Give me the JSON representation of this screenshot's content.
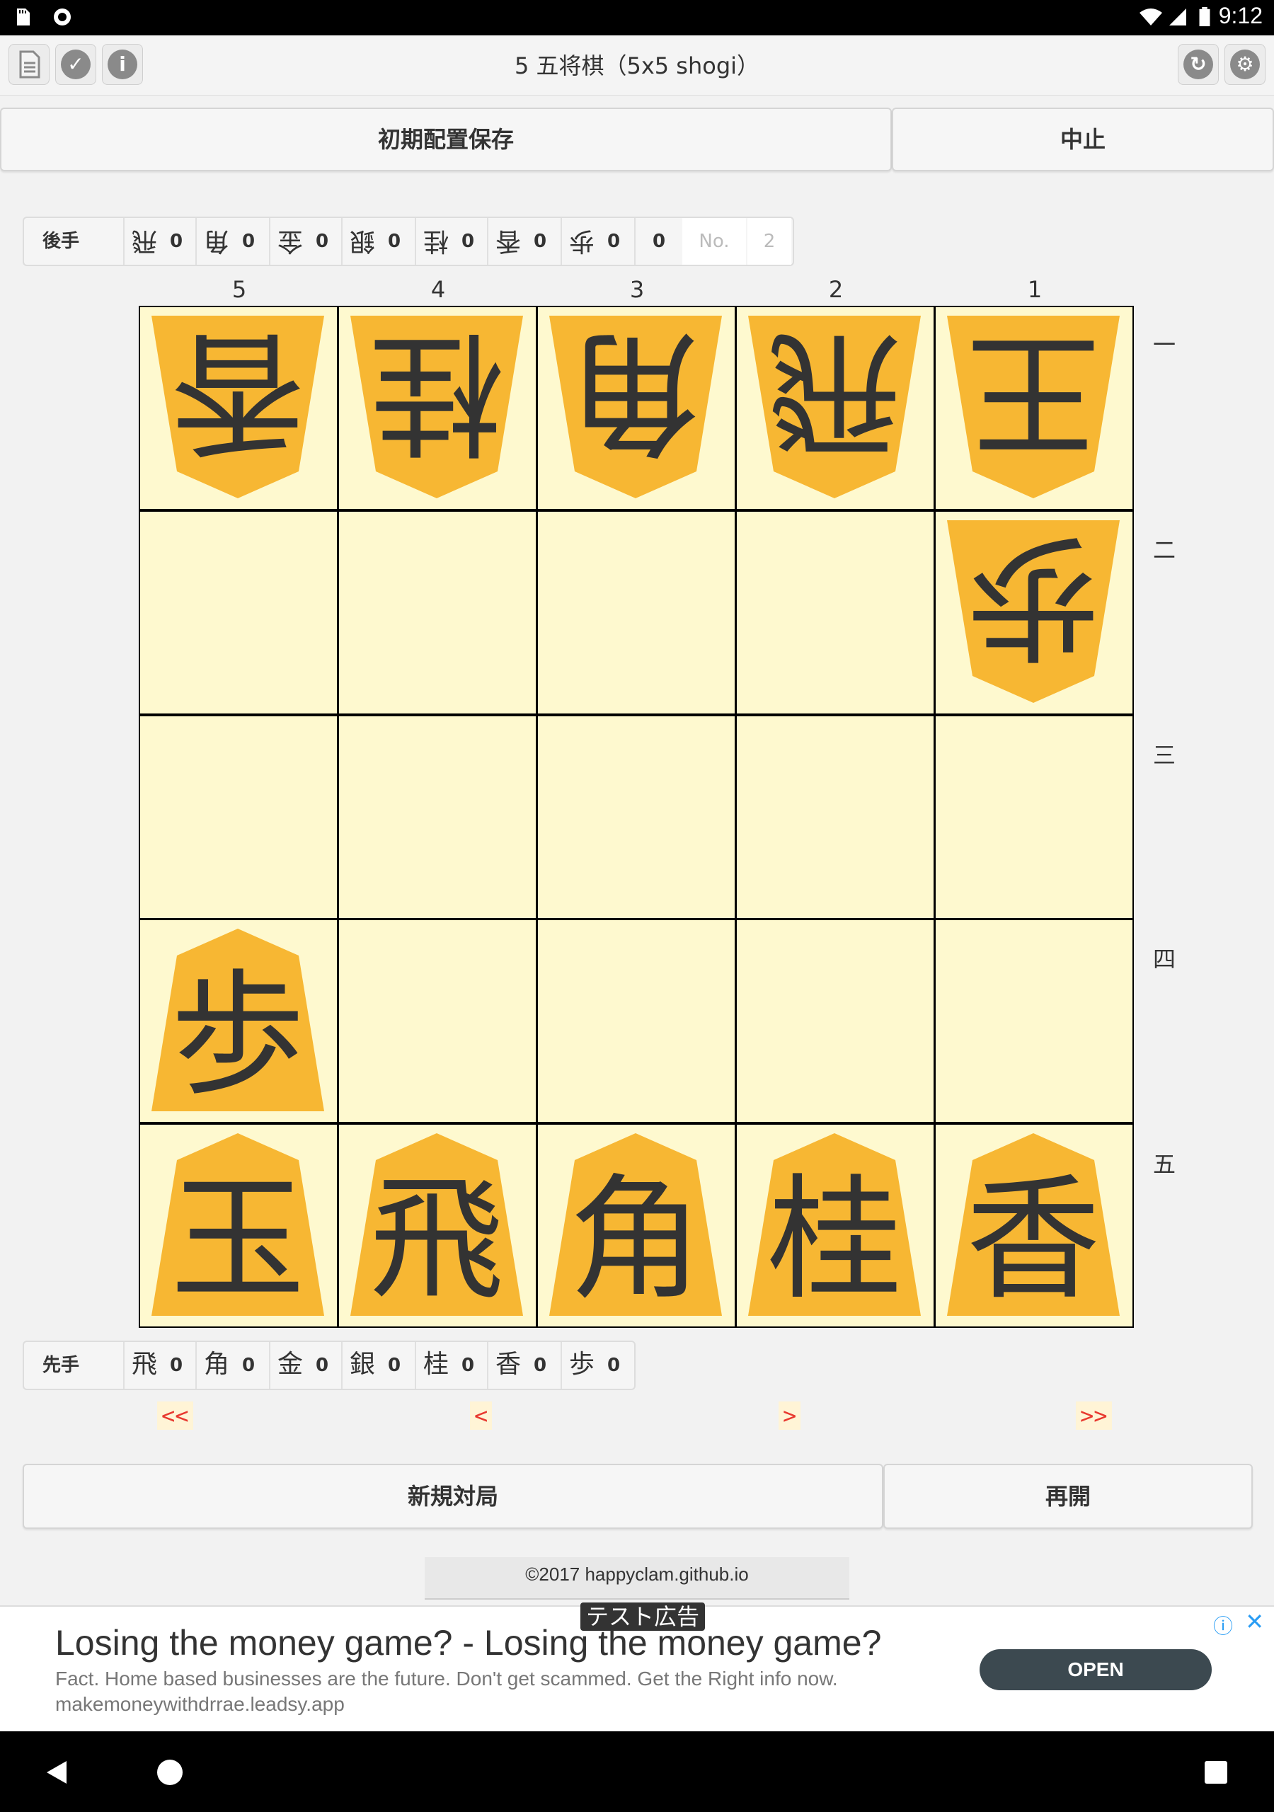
{
  "status_bar": {
    "time": "9:12"
  },
  "title": "5 五将棋（5x5 shogi）",
  "toolbar": {
    "save_initial": "初期配置保存",
    "abort": "中止"
  },
  "gote": {
    "label": "後手",
    "captured": [
      {
        "kanji": "飛",
        "count": "0"
      },
      {
        "kanji": "角",
        "count": "0"
      },
      {
        "kanji": "金",
        "count": "0"
      },
      {
        "kanji": "銀",
        "count": "0"
      },
      {
        "kanji": "桂",
        "count": "0"
      },
      {
        "kanji": "香",
        "count": "0"
      },
      {
        "kanji": "歩",
        "count": "0"
      }
    ],
    "extra_count": "0",
    "no_label": "No.",
    "move_no": "2"
  },
  "sente": {
    "label": "先手",
    "captured": [
      {
        "kanji": "飛",
        "count": "0"
      },
      {
        "kanji": "角",
        "count": "0"
      },
      {
        "kanji": "金",
        "count": "0"
      },
      {
        "kanji": "銀",
        "count": "0"
      },
      {
        "kanji": "桂",
        "count": "0"
      },
      {
        "kanji": "香",
        "count": "0"
      },
      {
        "kanji": "歩",
        "count": "0"
      }
    ]
  },
  "board": {
    "columns": [
      "5",
      "4",
      "3",
      "2",
      "1"
    ],
    "rows": [
      "一",
      "二",
      "三",
      "四",
      "五"
    ],
    "pieces": [
      {
        "row": 0,
        "col": 0,
        "kanji": "香",
        "owner": "gote"
      },
      {
        "row": 0,
        "col": 1,
        "kanji": "桂",
        "owner": "gote"
      },
      {
        "row": 0,
        "col": 2,
        "kanji": "角",
        "owner": "gote"
      },
      {
        "row": 0,
        "col": 3,
        "kanji": "飛",
        "owner": "gote"
      },
      {
        "row": 0,
        "col": 4,
        "kanji": "王",
        "owner": "gote"
      },
      {
        "row": 1,
        "col": 4,
        "kanji": "歩",
        "owner": "gote"
      },
      {
        "row": 3,
        "col": 0,
        "kanji": "歩",
        "owner": "sente"
      },
      {
        "row": 4,
        "col": 0,
        "kanji": "玉",
        "owner": "sente"
      },
      {
        "row": 4,
        "col": 1,
        "kanji": "飛",
        "owner": "sente"
      },
      {
        "row": 4,
        "col": 2,
        "kanji": "角",
        "owner": "sente"
      },
      {
        "row": 4,
        "col": 3,
        "kanji": "桂",
        "owner": "sente"
      },
      {
        "row": 4,
        "col": 4,
        "kanji": "香",
        "owner": "sente"
      }
    ]
  },
  "navigation": {
    "first": "<<",
    "prev": "<",
    "next": ">",
    "last": ">>"
  },
  "actions": {
    "new_game": "新規対局",
    "resume": "再開"
  },
  "footer": {
    "copyright": "©2017 happyclam.github.io"
  },
  "ad": {
    "badge": "テスト広告",
    "headline": "Losing the money game? - Losing the money game?",
    "description": "Fact. Home based businesses are the future. Don't get scammed. Get the Right info now.",
    "url": "makemoneywithdrrae.leadsy.app",
    "cta": "OPEN"
  },
  "colors": {
    "board": "#fef9cf",
    "piece": "#f7b733",
    "grid": "#000000",
    "nav_arrow": "#e8382f"
  },
  "icons": [
    "sd-card-icon",
    "circle-icon",
    "wifi-icon",
    "signal-icon",
    "battery-icon",
    "document-icon",
    "check-icon",
    "info-icon",
    "refresh-icon",
    "settings-icon",
    "back-icon",
    "home-icon",
    "recents-icon"
  ]
}
